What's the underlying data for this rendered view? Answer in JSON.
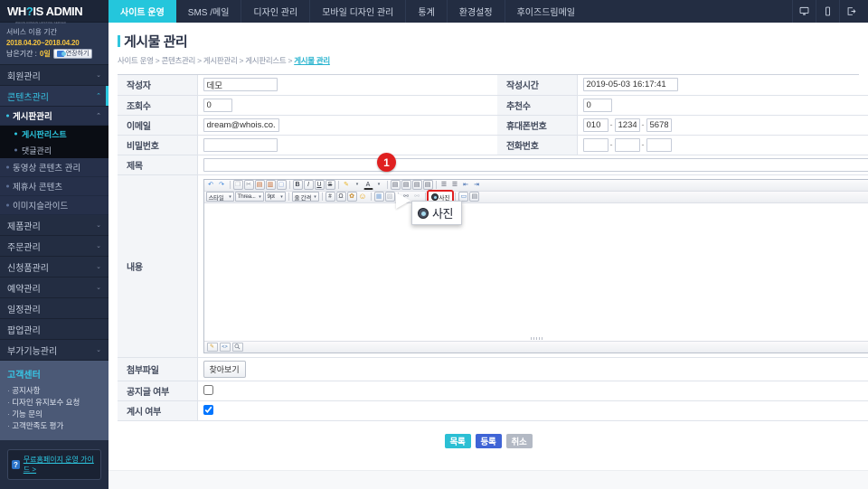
{
  "brand": {
    "name": "WH?IS ADMIN",
    "sub": "WHOIS DOMAIN HOSTING SERVER"
  },
  "service_period": {
    "title": "서비스 이용 기간",
    "range": "2018.04.20~2018.04.20",
    "remaining_label": "남은기간 : ",
    "remaining_value": "0일",
    "extend_button": "연장하기"
  },
  "topnav": {
    "items": [
      {
        "label": "사이트 운영",
        "active": true
      },
      {
        "label": "SMS /메일",
        "active": false
      },
      {
        "label": "디자인 관리",
        "active": false
      },
      {
        "label": "모바일 디자인 관리",
        "active": false
      },
      {
        "label": "통계",
        "active": false
      },
      {
        "label": "환경설정",
        "active": false
      },
      {
        "label": "후이즈드림메일",
        "active": false
      }
    ],
    "icons": [
      "desktop-icon",
      "mobile-icon",
      "logout-icon"
    ]
  },
  "sidebar": {
    "groups": [
      {
        "label": "회원관리"
      },
      {
        "label": "콘텐츠관리"
      },
      {
        "label": "제품관리"
      },
      {
        "label": "주문관리"
      },
      {
        "label": "신청품관리"
      },
      {
        "label": "예약관리"
      },
      {
        "label": "일정관리"
      },
      {
        "label": "팝업관리"
      },
      {
        "label": "부가기능관리"
      }
    ],
    "content_sub": [
      {
        "label": "게시판관리",
        "selected": true
      },
      {
        "label": "동영상 콘텐츠 관리",
        "selected": false
      },
      {
        "label": "제휴사 콘텐츠",
        "selected": false
      },
      {
        "label": "이미지슬라이드",
        "selected": false
      }
    ],
    "board_sub": [
      {
        "label": "게시판리스트",
        "current": true
      },
      {
        "label": "댓글관리",
        "current": false
      }
    ],
    "customer_center": {
      "title": "고객센터",
      "items": [
        "공지사항",
        "디자인 유지보수 요청",
        "기능 문의",
        "고객만족도 평가"
      ]
    },
    "guide_button": "무료홈페이지 운영 가이드 >"
  },
  "page": {
    "title": "게시물 관리",
    "breadcrumb": [
      "사이트 운영",
      "콘텐츠관리",
      "게시판관리",
      "게시판리스트"
    ],
    "breadcrumb_current": "게시물 관리"
  },
  "form": {
    "writer": {
      "label": "작성자",
      "value": "데모"
    },
    "created": {
      "label": "작성시간",
      "value": "2019-05-03 16:17:41"
    },
    "views": {
      "label": "조회수",
      "value": "0"
    },
    "recommends": {
      "label": "추천수",
      "value": "0"
    },
    "email": {
      "label": "이메일",
      "value": "dream@whois.co.kr"
    },
    "mobile": {
      "label": "휴대폰번호",
      "p1": "010",
      "p2": "1234",
      "p3": "5678"
    },
    "password": {
      "label": "비밀번호",
      "value": ""
    },
    "phone": {
      "label": "전화번호",
      "p1": "",
      "p2": "",
      "p3": ""
    },
    "subject": {
      "label": "제목",
      "value": ""
    },
    "content": {
      "label": "내용",
      "value": ""
    },
    "attachment": {
      "label": "첨부파일",
      "browse_button": "찾아보기"
    },
    "notice": {
      "label": "공지글 여부",
      "checked": false
    },
    "publish": {
      "label": "계시 여부",
      "checked": true
    }
  },
  "editor": {
    "row1": [
      {
        "icon": "undo-icon",
        "glyph": "↶"
      },
      {
        "icon": "redo-icon",
        "glyph": "↷"
      },
      {
        "icon": "copy-icon",
        "glyph": "❐"
      },
      {
        "icon": "cut-icon",
        "glyph": "✂"
      },
      {
        "icon": "paste-icon",
        "glyph": "▤"
      },
      {
        "icon": "paste-special-icon",
        "glyph": "▥"
      },
      {
        "icon": "select-all-icon",
        "glyph": "▢"
      },
      {
        "icon": "bold-icon",
        "glyph": "B"
      },
      {
        "icon": "italic-icon",
        "glyph": "I"
      },
      {
        "icon": "underline-icon",
        "glyph": "U"
      },
      {
        "icon": "strike-icon",
        "glyph": "S"
      },
      {
        "icon": "highlight-color-icon",
        "glyph": "✎"
      },
      {
        "icon": "font-color-icon",
        "glyph": "A"
      },
      {
        "icon": "align-left-icon",
        "glyph": "▤"
      },
      {
        "icon": "align-center-icon",
        "glyph": "▤"
      },
      {
        "icon": "align-right-icon",
        "glyph": "▤"
      },
      {
        "icon": "align-justify-icon",
        "glyph": "▤"
      },
      {
        "icon": "list-bullet-icon",
        "glyph": "☰"
      },
      {
        "icon": "list-number-icon",
        "glyph": "☰"
      },
      {
        "icon": "outdent-icon",
        "glyph": "⇤"
      },
      {
        "icon": "indent-icon",
        "glyph": "⇥"
      }
    ],
    "style_select": "스타일",
    "font_select": "Threa...",
    "size_select": "9pt",
    "linespacing_select": "줄 간격",
    "row2_icons": [
      {
        "icon": "special-char-icon",
        "glyph": "＃"
      },
      {
        "icon": "omega-icon",
        "glyph": "Ω"
      },
      {
        "icon": "emoticon-icon",
        "glyph": "✿"
      },
      {
        "icon": "smiley-icon",
        "glyph": "☺"
      },
      {
        "icon": "table-icon",
        "glyph": "▦"
      },
      {
        "icon": "table-prop-icon",
        "glyph": "▨"
      },
      {
        "icon": "link-icon",
        "glyph": "⛓"
      },
      {
        "icon": "unlink-icon",
        "glyph": "⛓"
      }
    ],
    "photo_button": "사진",
    "row2_tail": [
      {
        "icon": "movie-icon",
        "glyph": "▭"
      },
      {
        "icon": "file-icon",
        "glyph": "▤"
      }
    ],
    "footer_tabs": [
      {
        "icon": "edit-mode-icon",
        "glyph": "✎"
      },
      {
        "icon": "html-mode-icon",
        "glyph": "<>"
      },
      {
        "icon": "preview-mode-icon",
        "glyph": "🔍"
      }
    ]
  },
  "actions": {
    "list": "목록",
    "register": "등록",
    "cancel": "취소"
  },
  "callout": {
    "number": "1",
    "tooltip_label": "사진"
  },
  "colors": {
    "accent_cyan": "#24c6dc",
    "sidebar_bg": "#232d42",
    "highlight_red": "#e02020",
    "register_blue": "#3f64d6"
  }
}
